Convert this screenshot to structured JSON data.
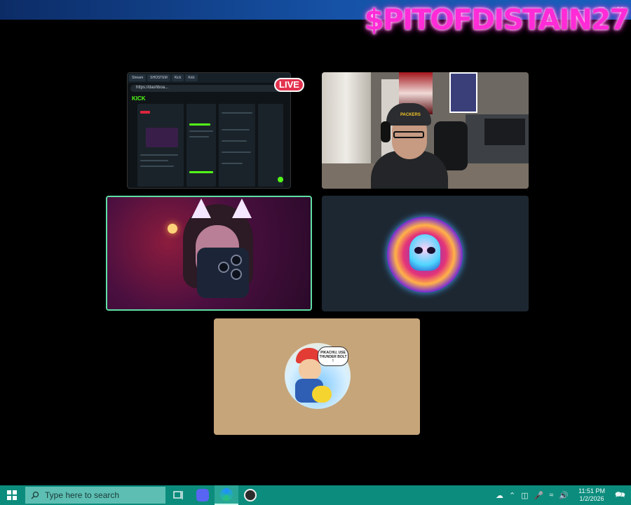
{
  "overlay": {
    "username": "$PITOFDISTAIN27"
  },
  "window": {
    "minimize_icon": "minimize-icon",
    "maximize_icon": "maximize-icon",
    "close_icon": "close-icon"
  },
  "stream": {
    "live_label": "LIVE",
    "screenshare": {
      "tabs": [
        "Stream",
        "SHOSTEM",
        "Kick",
        "Kick"
      ],
      "url": "https://dashboa..."
    }
  },
  "avatars": {
    "ash_bubble": "PIKACHU, USE THUNDER BOLT !"
  },
  "taskbar": {
    "search_placeholder": "Type here to search",
    "apps": [
      "task-view-icon",
      "discord-icon",
      "edge-icon",
      "obs-icon"
    ],
    "tray_icons": [
      "weather-icon",
      "chevron-up-icon",
      "network-icon",
      "microphone-icon",
      "wifi-icon",
      "volume-icon"
    ],
    "time": "11:51 PM",
    "date": "1/2/2026"
  },
  "colors": {
    "taskbar": "#0c8c7d",
    "overlay_text": "#ff2bd6",
    "live_badge": "#e3324e",
    "active_speaker_border": "#5fe0a6"
  }
}
